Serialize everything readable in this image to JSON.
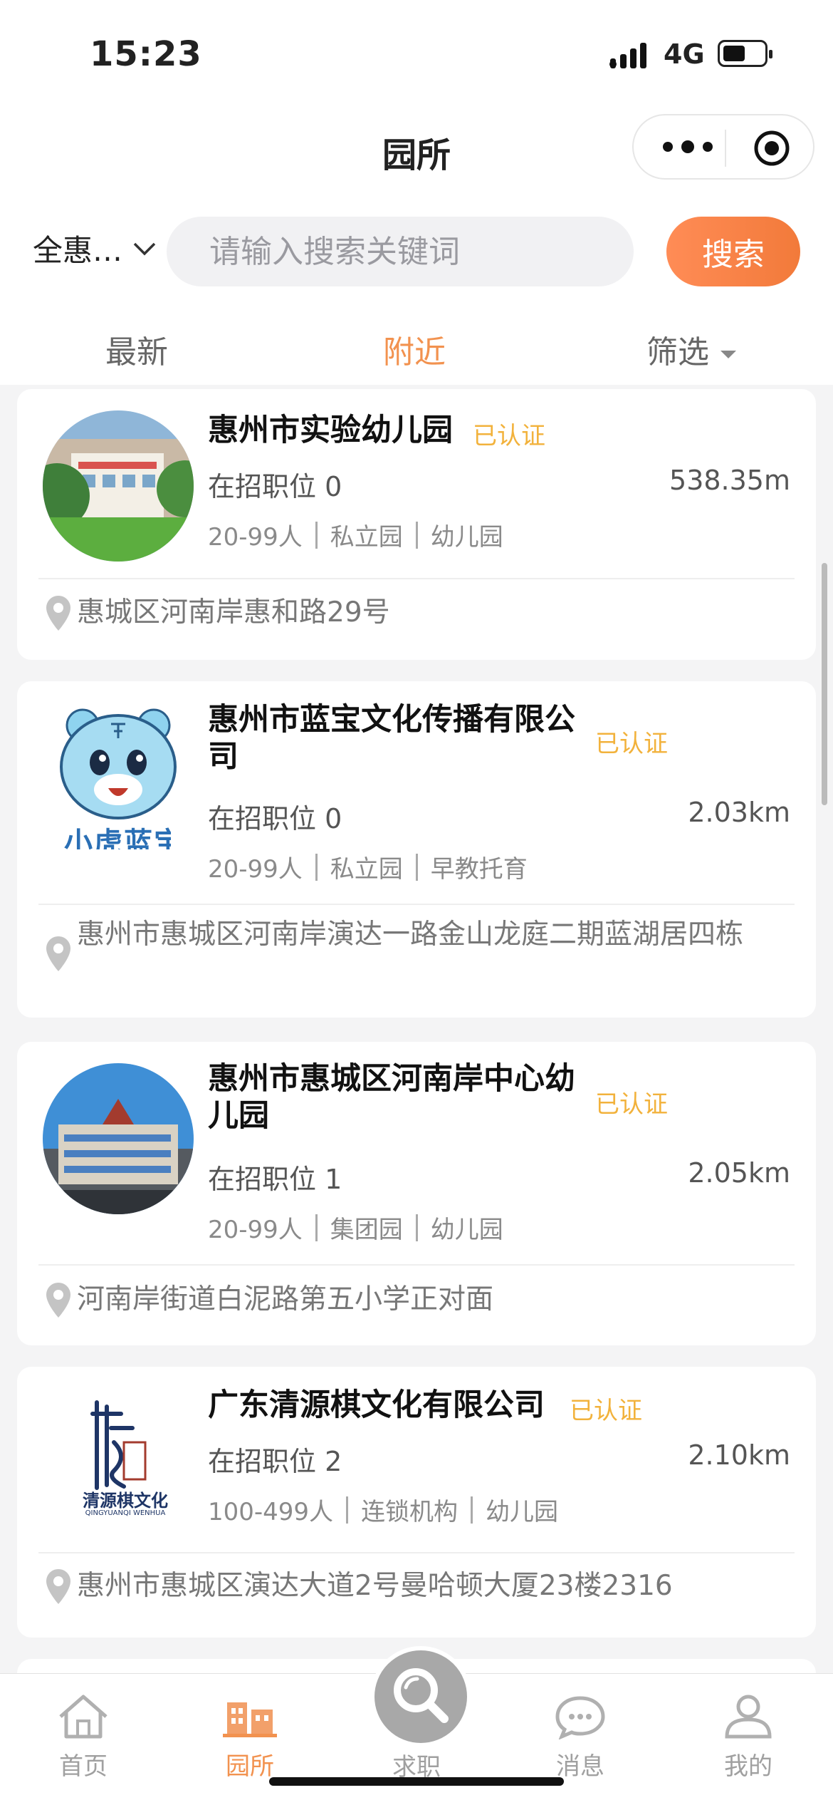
{
  "status_bar": {
    "time": "15:23",
    "network": "4G"
  },
  "header": {
    "title": "园所"
  },
  "search": {
    "region": "全惠…",
    "placeholder": "请输入搜索关键词",
    "button_label": "搜索"
  },
  "tabs": [
    {
      "label": "最新",
      "active": false
    },
    {
      "label": "附近",
      "active": true
    },
    {
      "label": "筛选",
      "active": false
    }
  ],
  "listings": [
    {
      "name": "惠州市实验幼儿园",
      "verified": "已认证",
      "positions": "在招职位 0",
      "distance": "538.35m",
      "meta": [
        "20-99人",
        "私立园",
        "幼儿园"
      ],
      "address": "惠城区河南岸惠和路29号",
      "logo_icon": "kindergarten-photo"
    },
    {
      "name": "惠州市蓝宝文化传播有限公司",
      "verified": "已认证",
      "positions": "在招职位 0",
      "distance": "2.03km",
      "meta": [
        "20-99人",
        "私立园",
        "早教托育"
      ],
      "address": "惠州市惠城区河南岸演达一路金山龙庭二期蓝湖居四栋",
      "logo_icon": "tiger-mascot",
      "logo_text": "小虎蓝宝"
    },
    {
      "name": "惠州市惠城区河南岸中心幼儿园",
      "verified": "已认证",
      "positions": "在招职位 1",
      "distance": "2.05km",
      "meta": [
        "20-99人",
        "集团园",
        "幼儿园"
      ],
      "address": "河南岸街道白泥路第五小学正对面",
      "logo_icon": "building-photo"
    },
    {
      "name": "广东清源棋文化有限公司",
      "verified": "已认证",
      "positions": "在招职位 2",
      "distance": "2.10km",
      "meta": [
        "100-499人",
        "连锁机构",
        "幼儿园"
      ],
      "address": "惠州市惠城区演达大道2号曼哈顿大厦23楼2316",
      "logo_icon": "calligraphy-logo",
      "logo_text": "清源棋文化",
      "logo_subtext": "QINGYUANQI WENHUA"
    }
  ],
  "bottom_nav": [
    {
      "label": "首页",
      "icon": "home-icon",
      "active": false
    },
    {
      "label": "园所",
      "icon": "school-icon",
      "active": true
    },
    {
      "label": "求职",
      "icon": "search-icon",
      "active": false
    },
    {
      "label": "消息",
      "icon": "message-icon",
      "active": false
    },
    {
      "label": "我的",
      "icon": "profile-icon",
      "active": false
    }
  ],
  "colors": {
    "accent": "#f2924f",
    "verified": "#f2b23c",
    "search_button": "#f27a3a"
  }
}
